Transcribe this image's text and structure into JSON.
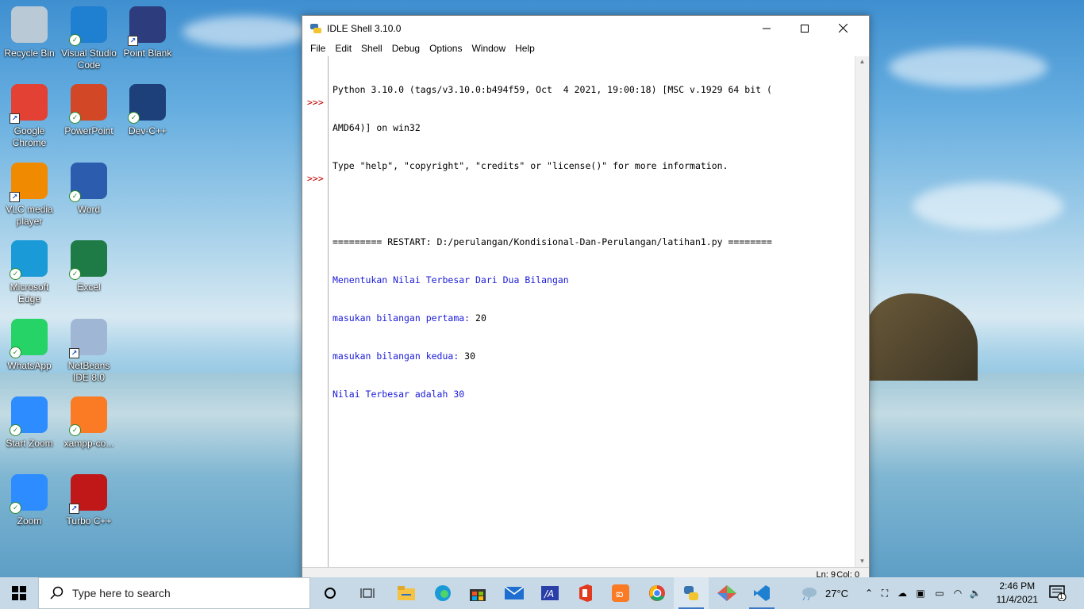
{
  "desktop": {
    "icons": [
      {
        "label": "Recycle Bin",
        "icon": "recycle-bin-icon",
        "color": "#b9c9d6"
      },
      {
        "label": "Visual Studio Code",
        "icon": "vscode-icon",
        "color": "#1f7fd0"
      },
      {
        "label": "Point Blank",
        "icon": "point-blank-icon",
        "color": "#2c3c7c"
      },
      {
        "label": "Google Chrome",
        "icon": "chrome-icon",
        "color": "#e34133"
      },
      {
        "label": "PowerPoint",
        "icon": "powerpoint-icon",
        "color": "#d24726"
      },
      {
        "label": "Dev-C++",
        "icon": "devcpp-icon",
        "color": "#1d3f7a"
      },
      {
        "label": "VLC media player",
        "icon": "vlc-icon",
        "color": "#f08a00"
      },
      {
        "label": "Word",
        "icon": "word-icon",
        "color": "#2b5cad"
      },
      {
        "label": "Microsoft Edge",
        "icon": "edge-icon",
        "color": "#1a9ad6"
      },
      {
        "label": "Excel",
        "icon": "excel-icon",
        "color": "#1e7b45"
      },
      {
        "label": "WhatsApp",
        "icon": "whatsapp-icon",
        "color": "#25d366"
      },
      {
        "label": "NetBeans IDE 8.0",
        "icon": "netbeans-icon",
        "color": "#9fb7d4"
      },
      {
        "label": "Start Zoom",
        "icon": "zoom-icon",
        "color": "#2d8cff"
      },
      {
        "label": "xampp-co...",
        "icon": "xampp-icon",
        "color": "#fb7a24"
      },
      {
        "label": "Zoom",
        "icon": "zoom-icon",
        "color": "#2d8cff"
      },
      {
        "label": "Turbo C++",
        "icon": "turbo-cpp-icon",
        "color": "#c01818"
      }
    ]
  },
  "window": {
    "title": "IDLE Shell 3.10.0",
    "menu": [
      "File",
      "Edit",
      "Shell",
      "Debug",
      "Options",
      "Window",
      "Help"
    ],
    "lines": [
      "Python 3.10.0 (tags/v3.10.0:b494f59, Oct  4 2021, 19:00:18) [MSC v.1929 64 bit (",
      "AMD64)] on win32",
      "Type \"help\", \"copyright\", \"credits\" or \"license()\" for more information.",
      "",
      "========= RESTART: D:/perulangan/Kondisional-Dan-Perulangan/latihan1.py ========",
      "Menentukan Nilai Terbesar Dari Dua Bilangan",
      "masukan bilangan pertama: ",
      "masukan bilangan kedua: ",
      "Nilai Terbesar adalah 30"
    ],
    "input_pertama": "20",
    "input_kedua": "30",
    "prompt": ">>>",
    "status_ln": "Ln: 9",
    "status_col": "Col: 0"
  },
  "taskbar": {
    "search_placeholder": "Type here to search",
    "weather": "27°C",
    "time": "2:46 PM",
    "date": "11/4/2021",
    "notification_count": "1"
  }
}
